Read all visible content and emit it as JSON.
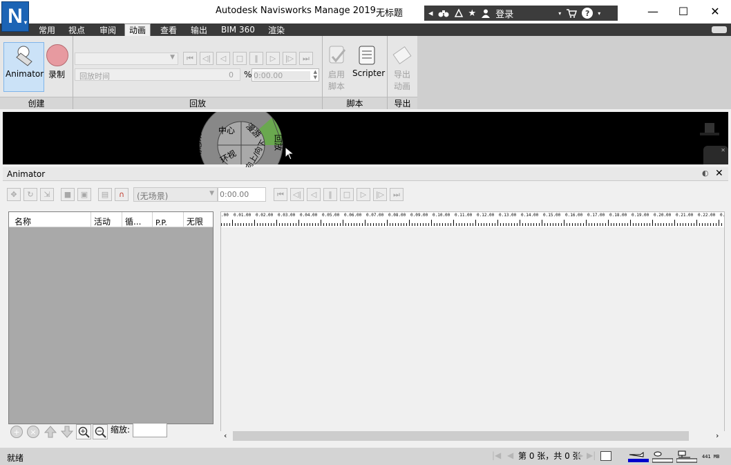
{
  "titlebar": {
    "app_title": "Autodesk Navisworks Manage 2019",
    "doc_title": "无标题",
    "login_label": "登录",
    "app_logo_letter": "N"
  },
  "ribbon": {
    "tabs": [
      "常用",
      "视点",
      "审阅",
      "动画",
      "查看",
      "输出",
      "BIM 360",
      "渲染"
    ],
    "active_tab": "动画",
    "create": {
      "animator_label": "Animator",
      "record_label": "录制",
      "panel_label": "创建"
    },
    "playback": {
      "time_label": "回放时间",
      "time_value": "0",
      "percent": "%",
      "time_display": "0:00.00",
      "panel_label": "回放"
    },
    "script": {
      "enable_label_1": "启用",
      "enable_label_2": "脚本",
      "scripter_label": "Scripter",
      "panel_label": "脚本"
    },
    "export": {
      "label_1": "导出",
      "label_2": "动画",
      "panel_label": "导出"
    }
  },
  "navwheel": {
    "items": [
      "中心",
      "漫游",
      "动态观察",
      "环视",
      "回放",
      "向上/向下"
    ]
  },
  "animator": {
    "title": "Animator",
    "scene_dropdown": "(无场景)",
    "time_value": "0:00.00",
    "columns": [
      "名称",
      "活动",
      "循...",
      "P.P.",
      "无限"
    ],
    "zoom_label": "缩放:",
    "ruler_labels": [
      ".00",
      "0.01.00",
      "0.02.00",
      "0.03.00",
      "0.04.00",
      "0.05.00",
      "0.06.00",
      "0.07.00",
      "0.08.00",
      "0.09.00",
      "0.10.00",
      "0.11.00",
      "0.12.00",
      "0.13.00",
      "0.14.00",
      "0.15.00",
      "0.16.00",
      "0.17.00",
      "0.18.00",
      "0.19.00",
      "0.20.00",
      "0.21.00",
      "0.22.00",
      "0."
    ]
  },
  "statusbar": {
    "status": "就绪",
    "page_info": "第 0 张，共 0 张",
    "memory": "441 MB"
  },
  "colors": {
    "titlebar_dark": "#3c3c3c",
    "tabbar": "#3a3a3a",
    "logo_blue": "#1c64b5",
    "wheel_green": "#6aa84f",
    "memory_blue": "#0000cc"
  }
}
